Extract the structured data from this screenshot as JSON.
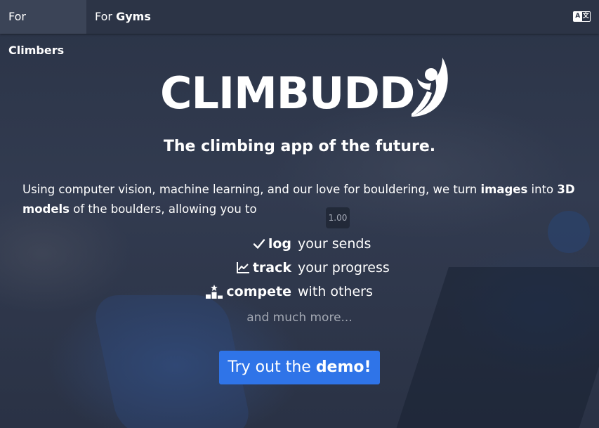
{
  "nav": {
    "tabs": [
      {
        "prefix": "For",
        "label": "Climbers",
        "active": true
      },
      {
        "prefix": "For",
        "label": "Gyms",
        "active": false
      }
    ],
    "language_icon": "translate-icon"
  },
  "hero": {
    "logo_text": "CLIMBUDD",
    "tagline": "The climbing app of the future.",
    "description": {
      "part1": "Using computer vision, machine learning, and our love for bouldering, we turn ",
      "bold1": "images",
      "part2": " into ",
      "bold2": "3D models",
      "part3": " of the boulders, allowing you to"
    },
    "speed_badge": "1.00",
    "features": [
      {
        "icon": "check-icon",
        "keyword": "log",
        "rest": "your sends"
      },
      {
        "icon": "chart-line-icon",
        "keyword": "track",
        "rest": "your progress"
      },
      {
        "icon": "podium-icon",
        "keyword": "compete",
        "rest": "with others"
      }
    ],
    "more": "and much more...",
    "cta": {
      "prefix": "Try out the ",
      "bold": "demo!"
    }
  },
  "colors": {
    "accent": "#2f74e8",
    "navbar": "#2c3446",
    "background": "#2b3447"
  }
}
